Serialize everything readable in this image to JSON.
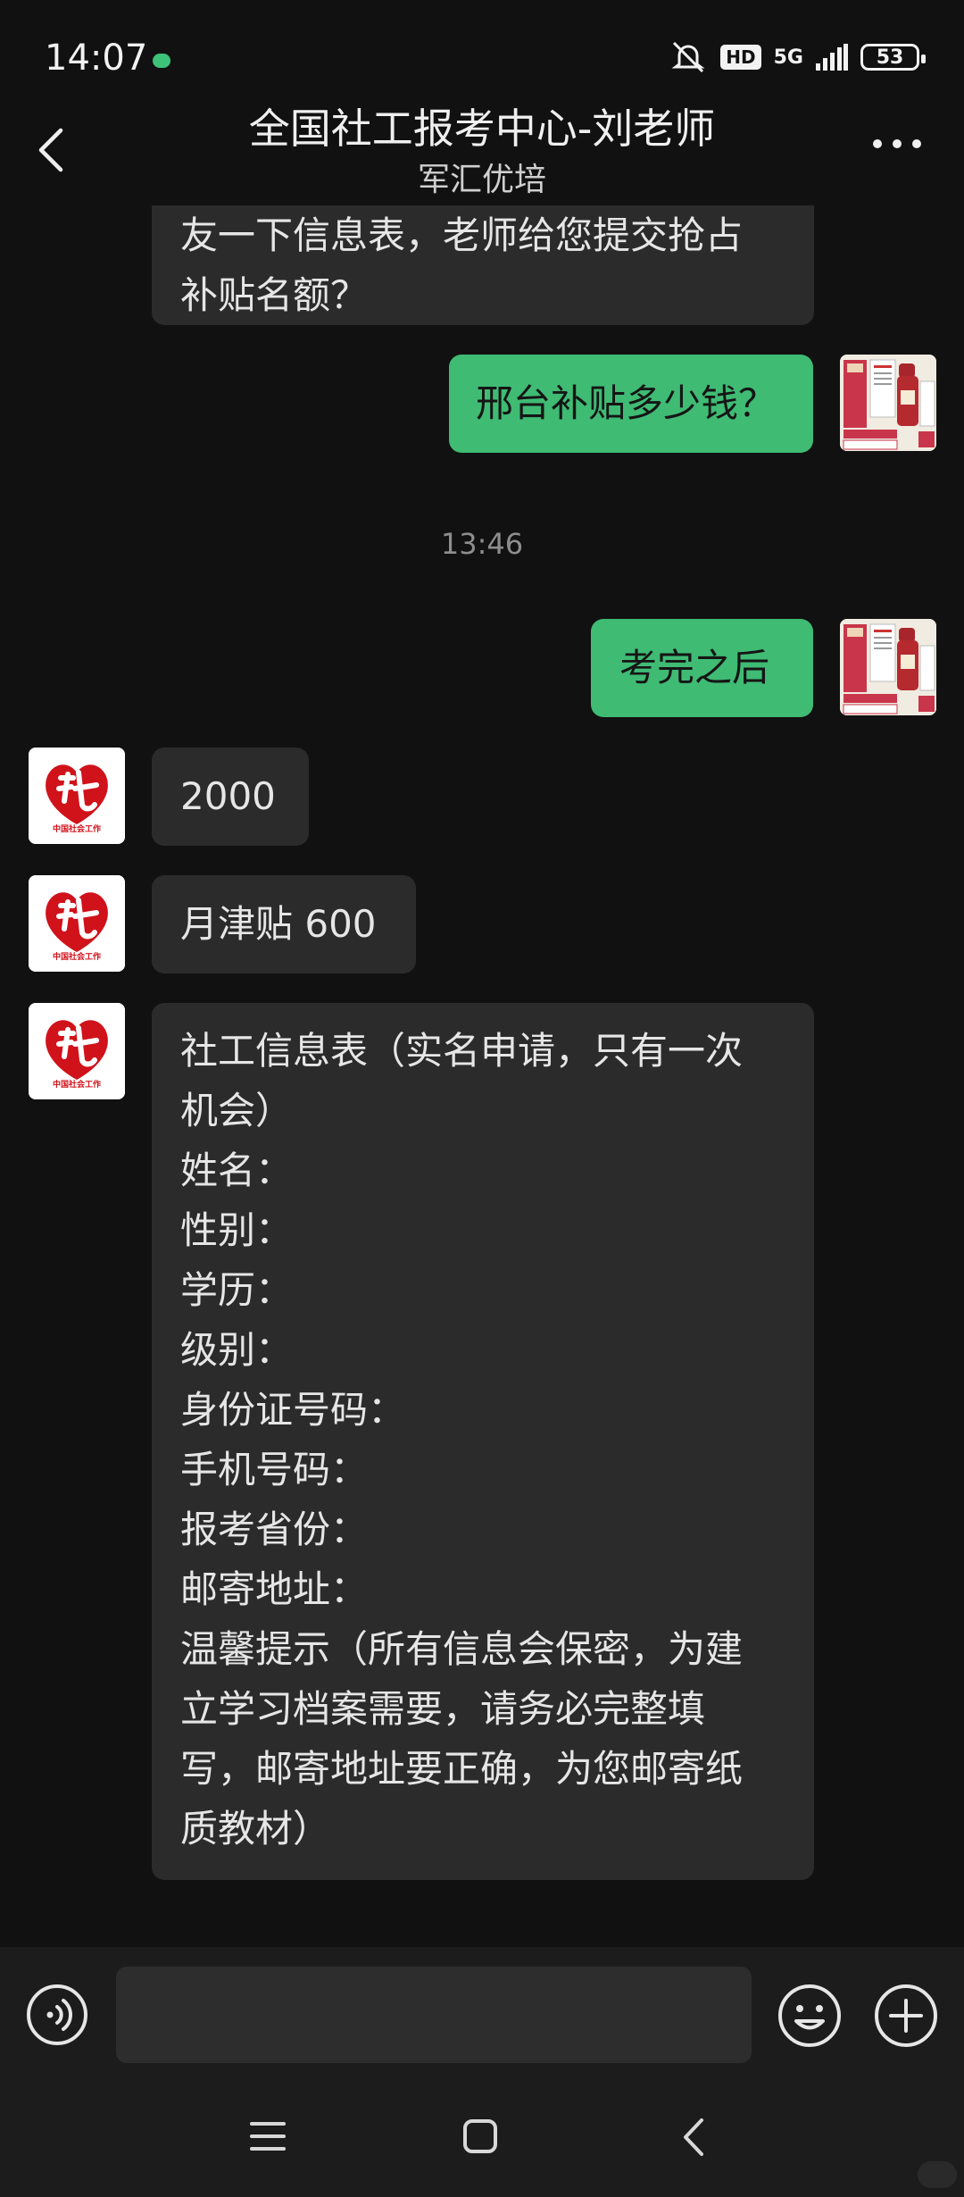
{
  "status_bar": {
    "time": "14:07",
    "network": "5G",
    "hd": "HD",
    "battery": "53"
  },
  "header": {
    "title": "全国社工报考中心-刘老师",
    "subtitle": "军汇优培"
  },
  "messages": [
    {
      "side": "in",
      "text": "友一下信息表，老师给您提交抢占\n补贴名额？"
    },
    {
      "side": "out",
      "text": "邢台补贴多少钱？"
    },
    {
      "type": "time",
      "text": "13:46"
    },
    {
      "side": "out",
      "text": "考完之后"
    },
    {
      "side": "in",
      "text": "2000"
    },
    {
      "side": "in",
      "text": "月津贴 600"
    },
    {
      "side": "in",
      "text": "社工信息表（实名申请，只有一次\n机会）\n姓名：\n性别：\n学历：\n级别：\n身份证号码：\n手机号码：\n报考省份：\n邮寄地址：\n温馨提示（所有信息会保密，为建\n立学习档案需要，请务必完整填\n写，邮寄地址要正确，为您邮寄纸\n质教材）"
    }
  ],
  "avatar_logo_text": "中国社会工作",
  "input": {
    "value": "",
    "placeholder": ""
  },
  "colors": {
    "background": "#111111",
    "incoming_bubble": "#2b2b2b",
    "outgoing_bubble": "#3fbb74",
    "accent_logo": "#d0121b"
  },
  "icons": [
    "chevron-left-icon",
    "more-dots-icon",
    "voice-icon",
    "emoji-icon",
    "plus-icon",
    "nav-menu-icon",
    "nav-home-icon",
    "nav-back-icon",
    "mute-icon",
    "signal-icon",
    "battery-icon"
  ]
}
